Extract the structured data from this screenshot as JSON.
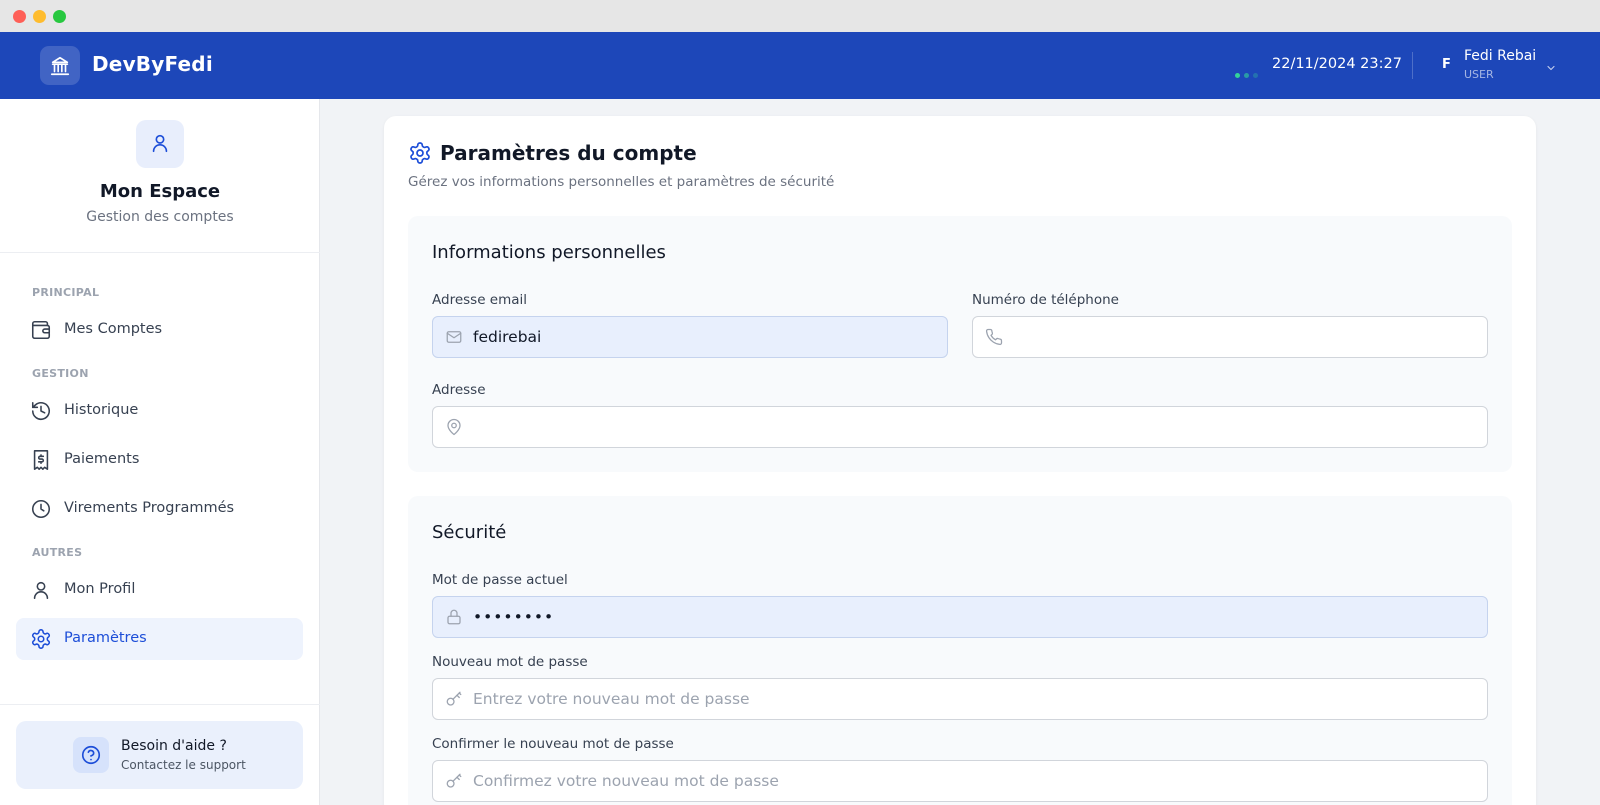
{
  "header": {
    "brand": "DevByFedi",
    "datetime": "22/11/2024 23:27",
    "user_initial": "F",
    "user_name": "Fedi Rebai",
    "user_role": "USER"
  },
  "sidebar": {
    "title": "Mon Espace",
    "subtitle": "Gestion des comptes",
    "sections": {
      "principal": "PRINCIPAL",
      "gestion": "GESTION",
      "autres": "AUTRES"
    },
    "items": [
      {
        "label": "Mes Comptes",
        "icon": "wallet-icon"
      },
      {
        "label": "Historique",
        "icon": "history-icon"
      },
      {
        "label": "Paiements",
        "icon": "receipt-icon"
      },
      {
        "label": "Virements Programmés",
        "icon": "clock-icon"
      },
      {
        "label": "Mon Profil",
        "icon": "user-icon"
      },
      {
        "label": "Paramètres",
        "icon": "gear-icon",
        "active": true
      }
    ],
    "help": {
      "title": "Besoin d'aide ?",
      "subtitle": "Contactez le support"
    }
  },
  "main": {
    "title": "Paramètres du compte",
    "subtitle": "Gérez vos informations personnelles et paramètres de sécurité",
    "personal": {
      "title": "Informations personnelles",
      "email_label": "Adresse email",
      "email_value": "fedirebai",
      "phone_label": "Numéro de téléphone",
      "phone_value": "",
      "address_label": "Adresse",
      "address_value": ""
    },
    "security": {
      "title": "Sécurité",
      "current_label": "Mot de passe actuel",
      "current_value": "••••••••",
      "new_label": "Nouveau mot de passe",
      "new_placeholder": "Entrez votre nouveau mot de passe",
      "confirm_label": "Confirmer le nouveau mot de passe",
      "confirm_placeholder": "Confirmez votre nouveau mot de passe"
    }
  },
  "colors": {
    "header_bg": "#1d47b9",
    "accent": "#1d4ed8",
    "active_bg": "#eef3fd",
    "status_dot": "#34d399"
  }
}
